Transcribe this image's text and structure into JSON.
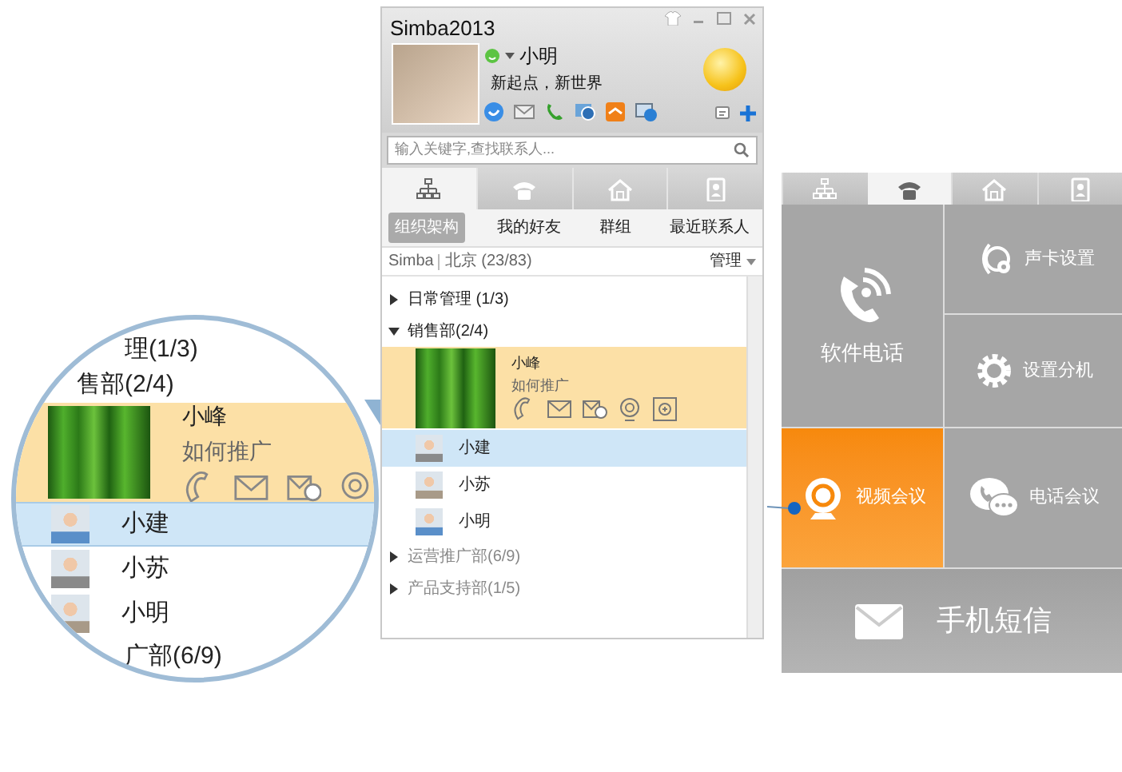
{
  "window": {
    "title": "Simba2013",
    "user": {
      "name": "小明",
      "signature": "新起点，新世界"
    }
  },
  "search": {
    "placeholder": "输入关键字,查找联系人..."
  },
  "main_tabs": [
    {
      "kind": "org",
      "selected": true
    },
    {
      "kind": "phone",
      "selected": false
    },
    {
      "kind": "home",
      "selected": false
    },
    {
      "kind": "contact",
      "selected": false
    }
  ],
  "sub_tabs": [
    {
      "label": "组织架构",
      "selected": true
    },
    {
      "label": "我的好友",
      "selected": false
    },
    {
      "label": "群组",
      "selected": false
    },
    {
      "label": "最近联系人",
      "selected": false
    }
  ],
  "org_bar": {
    "company": "Simba",
    "location": "北京 (23/83)",
    "action": "管理"
  },
  "tree": [
    {
      "label": "日常管理 (1/3)",
      "expanded": false
    },
    {
      "label": "销售部(2/4)",
      "expanded": true,
      "children": [
        {
          "kind": "card",
          "name": "小峰",
          "status": "如何推广"
        },
        {
          "kind": "contact",
          "name": "小建",
          "selected": true
        },
        {
          "kind": "contact",
          "name": "小苏",
          "selected": false
        },
        {
          "kind": "contact",
          "name": "小明",
          "selected": false
        }
      ]
    },
    {
      "label": "运营推广部(6/9)",
      "expanded": false
    },
    {
      "label": "产品支持部(1/5)",
      "expanded": false
    }
  ],
  "magnifier": {
    "rows": [
      {
        "kind": "group",
        "label": "理(1/3)"
      },
      {
        "kind": "group",
        "label": "售部(2/4)"
      },
      {
        "kind": "card",
        "name": "小峰",
        "status": "如何推广"
      },
      {
        "kind": "contact",
        "name": "小建",
        "selected": true
      },
      {
        "kind": "contact",
        "name": "小苏",
        "selected": false
      },
      {
        "kind": "contact",
        "name": "小明",
        "selected": false
      },
      {
        "kind": "group",
        "label": "广部(6/9)"
      }
    ]
  },
  "phone_panel": {
    "tabs": [
      {
        "kind": "org",
        "selected": false
      },
      {
        "kind": "phone",
        "selected": true
      },
      {
        "kind": "home",
        "selected": false
      },
      {
        "kind": "contact",
        "selected": false
      }
    ],
    "tiles": [
      {
        "kind": "softphone",
        "label": "软件电话",
        "selected": false
      },
      {
        "kind": "soundcard",
        "label": "声卡设置",
        "selected": false
      },
      {
        "kind": "extension",
        "label": "设置分机",
        "selected": false
      },
      {
        "kind": "video",
        "label": "视频会议",
        "selected": true
      },
      {
        "kind": "conference",
        "label": "电话会议",
        "selected": false
      },
      {
        "kind": "sms",
        "label": "手机短信",
        "selected": false
      }
    ]
  }
}
